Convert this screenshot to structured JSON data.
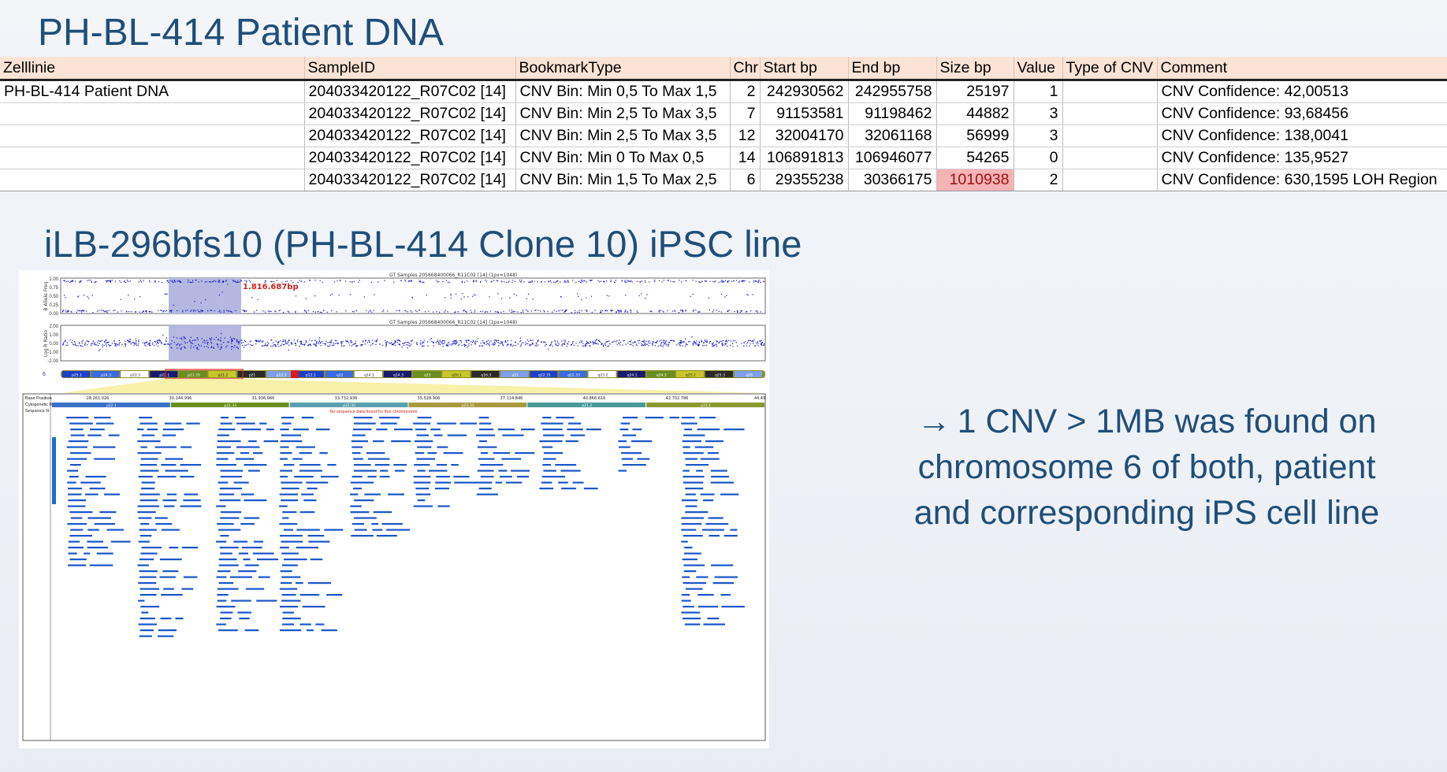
{
  "title": "PH-BL-414 Patient DNA",
  "table": {
    "headers": [
      "Zelllinie",
      "SampleID",
      "BookmarkType",
      "Chr",
      "Start bp",
      "End bp",
      "Size bp",
      "Value",
      "Type of CNV",
      "Comment"
    ],
    "rows": [
      [
        "PH-BL-414 Patient DNA",
        "204033420122_R07C02 [14]",
        "CNV Bin: Min 0,5 To Max 1,5",
        "2",
        "242930562",
        "242955758",
        "25197",
        "1",
        "",
        "CNV Confidence: 42,00513"
      ],
      [
        "",
        "204033420122_R07C02 [14]",
        "CNV Bin: Min 2,5 To Max 3,5",
        "7",
        "91153581",
        "91198462",
        "44882",
        "3",
        "",
        "CNV Confidence: 93,68456"
      ],
      [
        "",
        "204033420122_R07C02 [14]",
        "CNV Bin: Min 2,5 To Max 3,5",
        "12",
        "32004170",
        "32061168",
        "56999",
        "3",
        "",
        "CNV Confidence: 138,0041"
      ],
      [
        "",
        "204033420122_R07C02 [14]",
        "CNV Bin: Min 0 To Max 0,5",
        "14",
        "106891813",
        "106946077",
        "54265",
        "0",
        "",
        "CNV Confidence: 135,9527"
      ],
      [
        "",
        "204033420122_R07C02 [14]",
        "CNV Bin: Min 1,5 To Max 2,5",
        "6",
        "29355238",
        "30366175",
        "1010938",
        "2",
        "",
        "CNV Confidence: 630,1595 LOH Region"
      ]
    ],
    "highlight_color": "#f6b3b6"
  },
  "subtitle": "iLB-296bfs10 (PH-BL-414 Clone 10) iPSC line",
  "genome_view": {
    "chromosome_label": "6",
    "baf_track_title": "GT Samples 205668400066_R11C02 [14] (1px=1048)",
    "lrr_track_title": "GT Samples 205668400066_R11C02 [14] (1px=1048)",
    "baf_axis_label": "B Allele Freq",
    "lrr_axis_label": "Log R Ratio",
    "baf_ticks": [
      "1.00",
      "0.75",
      "0.50",
      "0.25",
      "0.00"
    ],
    "lrr_ticks": [
      "2.00",
      "1.00",
      "0.00",
      "-1.00",
      "-2.00"
    ],
    "region_annotation": "1.816.687bp",
    "bands": [
      "p25.1",
      "p24.3",
      "p22.3",
      "p22.1",
      "p21.33",
      "p21.2",
      "p21",
      "p12.3",
      "p12.1",
      "q12",
      "q14.1",
      "q14.3",
      "q15",
      "q16.1",
      "q16.3",
      "q21",
      "q22.31",
      "q22.33",
      "q23.2",
      "q24.1",
      "q24.3",
      "q25.2",
      "q25.3",
      "q26"
    ],
    "detail_rows": [
      "Base Position",
      "Cytogenetic Band",
      "Sequence N"
    ],
    "positions": [
      "28.261.026",
      "30.144.996",
      "31.936.966",
      "33.732.936",
      "35.528.906",
      "37.114.846",
      "40.866.616",
      "42.702.786",
      "44.49"
    ],
    "detail_bands": [
      "p22.1",
      "p21.33",
      "p21.32",
      "p21.31",
      "p21.2",
      "p21.1"
    ],
    "warning": "No sequence data found for this chromosome"
  },
  "note": {
    "arrow": "→",
    "lines": [
      "1 CNV > 1MB was found on",
      "chromosome 6 of both, patient",
      "and corresponding iPS cell line"
    ]
  },
  "colors": {
    "title": "#1f4e79",
    "header_bg": "#fbe4d5",
    "scatter": "#1010cc",
    "region": "#b4b8e0",
    "annotation": "#d11f1f"
  }
}
